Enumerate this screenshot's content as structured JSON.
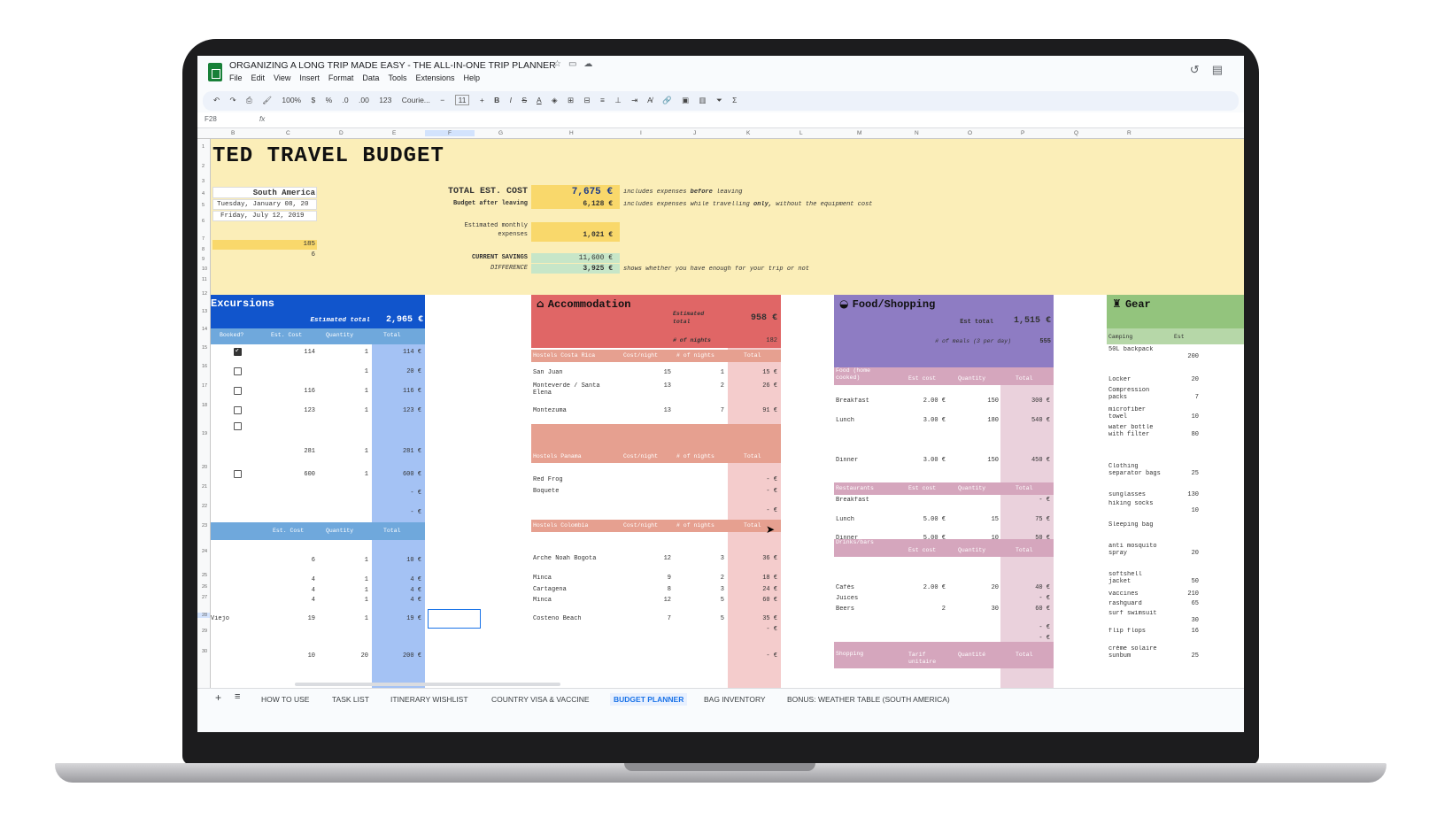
{
  "window": {
    "doc_title": "ORGANIZING A LONG TRIP MADE EASY - THE ALL-IN-ONE TRIP PLANNER",
    "menu": [
      "File",
      "Edit",
      "View",
      "Insert",
      "Format",
      "Data",
      "Tools",
      "Extensions",
      "Help"
    ]
  },
  "toolbar": {
    "zoom": "100%",
    "currency": "$",
    "percent": "%",
    "dec_less": ".0",
    ".00": ".00",
    "format_123": "123",
    "font": "Courie...",
    "font_size": "11"
  },
  "formula": {
    "cell_ref": "F28",
    "fx": "fx"
  },
  "columns": [
    "B",
    "C",
    "D",
    "E",
    "F",
    "G",
    "H",
    "I",
    "J",
    "K",
    "L",
    "M",
    "N",
    "O",
    "P",
    "Q",
    "R"
  ],
  "rows": [
    "1",
    "2",
    "3",
    "4",
    "5",
    "6",
    "7",
    "8",
    "9",
    "10",
    "11",
    "12",
    "13",
    "14",
    "15",
    "16",
    "17",
    "18",
    "19",
    "20",
    "21",
    "22",
    "23",
    "24",
    "25",
    "26",
    "27",
    "28",
    "29",
    "30"
  ],
  "header": {
    "title": "TED TRAVEL BUDGET",
    "destination": "South America",
    "start_date": "Tuesday, January 08, 20",
    "end_date": "Friday, July 12, 2019",
    "days": "185",
    "months": "6",
    "total_label": "TOTAL EST. COST",
    "total_value": "7,675 €",
    "total_note_a": "includes expenses",
    "total_note_b": "before",
    "total_note_c": "leaving",
    "after_label": "Budget after leaving",
    "after_value": "6,128 €",
    "after_note_a": "includes expenses while travelling",
    "after_note_b": "only,",
    "after_note_c": "without the equipment cost",
    "monthly_label_1": "Estimated monthly",
    "monthly_label_2": "expenses",
    "monthly_value": "1,021 €",
    "savings_label": "CURRENT SAVINGS",
    "savings_value": "11,600 €",
    "diff_label": "DIFFERENCE",
    "diff_value": "3,925 €",
    "diff_note": "shows whether you have enough for your trip or not"
  },
  "excursions": {
    "title": "Excursions",
    "est_total_label": "Estimated total",
    "est_total_value": "2,965 €",
    "headers": [
      "Booked?",
      "Est. Cost",
      "Quantity",
      "Total"
    ],
    "rows": [
      {
        "checked": true,
        "cost": "114",
        "qty": "1",
        "total": "114 €"
      },
      {
        "checked": false,
        "cost": "",
        "qty": "1",
        "total": "20 €"
      },
      {
        "checked": false,
        "cost": "116",
        "qty": "1",
        "total": "116 €"
      },
      {
        "checked": false,
        "cost": "123",
        "qty": "1",
        "total": "123 €"
      },
      {
        "checked": false,
        "cost": "281",
        "qty": "1",
        "total": "281 €"
      },
      {
        "checked": false,
        "cost": "600",
        "qty": "1",
        "total": "600 €"
      },
      {
        "checked": false,
        "cost": "",
        "qty": "",
        "total": "- €"
      },
      {
        "checked": false,
        "cost": "",
        "qty": "",
        "total": "- €"
      }
    ],
    "headers2": [
      "Est. Cost",
      "Quantity",
      "Total"
    ],
    "rows2": [
      {
        "name": "",
        "cost": "6",
        "qty": "1",
        "total": "10 €"
      },
      {
        "name": "",
        "cost": "4",
        "qty": "1",
        "total": "4 €"
      },
      {
        "name": "",
        "cost": "4",
        "qty": "1",
        "total": "4 €"
      },
      {
        "name": "",
        "cost": "4",
        "qty": "1",
        "total": "4 €"
      },
      {
        "name": "Viejo",
        "cost": "19",
        "qty": "1",
        "total": "19 €"
      },
      {
        "name": "",
        "cost": "10",
        "qty": "20",
        "total": "200 €"
      }
    ]
  },
  "accommodation": {
    "title": "Accommodation",
    "est_total_label_1": "Estimated",
    "est_total_label_2": "total",
    "est_total_value": "958 €",
    "nights_label": "# of nights",
    "nights_value": "182",
    "groups": [
      {
        "name": "Hostels Costa Rica",
        "cols": [
          "Cost/night",
          "# of nights",
          "Total"
        ],
        "rows": [
          {
            "name": "San Juan",
            "cost": "15",
            "nights": "1",
            "total": "15 €"
          },
          {
            "name": "Monteverde / Santa Elena",
            "cost": "13",
            "nights": "2",
            "total": "26 €"
          },
          {
            "name": "Montezuma",
            "cost": "13",
            "nights": "7",
            "total": "91 €"
          }
        ]
      },
      {
        "name": "Hostels Panama",
        "cols": [
          "Cost/night",
          "# of nights",
          "Total"
        ],
        "rows": [
          {
            "name": "Red Frog",
            "cost": "",
            "nights": "",
            "total": "- €"
          },
          {
            "name": "Boquete",
            "cost": "",
            "nights": "",
            "total": "- €"
          },
          {
            "name": "",
            "cost": "",
            "nights": "",
            "total": "- €"
          }
        ]
      },
      {
        "name": "Hostels Colombia",
        "cols": [
          "Cost/night",
          "# of nights",
          "Total"
        ],
        "rows": [
          {
            "name": "Arche Noah Bogota",
            "cost": "12",
            "nights": "3",
            "total": "36 €"
          },
          {
            "name": "Minca",
            "cost": "9",
            "nights": "2",
            "total": "18 €"
          },
          {
            "name": "Cartagena",
            "cost": "8",
            "nights": "3",
            "total": "24 €"
          },
          {
            "name": "Minca",
            "cost": "12",
            "nights": "5",
            "total": "60 €"
          },
          {
            "name": "Costeno Beach",
            "cost": "7",
            "nights": "5",
            "total": "35 €"
          },
          {
            "name": "",
            "cost": "",
            "nights": "",
            "total": "- €"
          },
          {
            "name": "",
            "cost": "",
            "nights": "",
            "total": "- €"
          }
        ]
      }
    ]
  },
  "food": {
    "title": "Food/Shopping",
    "est_total_label": "Est total",
    "est_total_value": "1,515 €",
    "meals_label": "# of meals (3 per day)",
    "meals_value": "555",
    "groups": [
      {
        "name": "Food (home cooked)",
        "cols": [
          "Est cost",
          "Quantity",
          "Total"
        ],
        "rows": [
          {
            "name": "Breakfast",
            "cost": "2.00 €",
            "qty": "150",
            "total": "300 €"
          },
          {
            "name": "Lunch",
            "cost": "3.00 €",
            "qty": "180",
            "total": "540 €"
          },
          {
            "name": "Dinner",
            "cost": "3.00 €",
            "qty": "150",
            "total": "450 €"
          }
        ]
      },
      {
        "name": "Restaurants",
        "cols": [
          "Est cost",
          "Quantity",
          "Total"
        ],
        "rows": [
          {
            "name": "Breakfast",
            "cost": "",
            "qty": "",
            "total": "- €"
          },
          {
            "name": "Lunch",
            "cost": "5.00 €",
            "qty": "15",
            "total": "75 €"
          },
          {
            "name": "Dinner",
            "cost": "5.00 €",
            "qty": "10",
            "total": "50 €"
          }
        ]
      },
      {
        "name": "Drinks/bars",
        "cols": [
          "Est cost",
          "Quantity",
          "Total"
        ],
        "rows": [
          {
            "name": "Cafés",
            "cost": "2.00 €",
            "qty": "20",
            "total": "40 €"
          },
          {
            "name": "Juices",
            "cost": "",
            "qty": "",
            "total": "- €"
          },
          {
            "name": "Beers",
            "cost": "2",
            "qty": "30",
            "total": "60 €"
          },
          {
            "name": "",
            "cost": "",
            "qty": "",
            "total": "- €"
          },
          {
            "name": "",
            "cost": "",
            "qty": "",
            "total": "- €"
          }
        ]
      },
      {
        "name": "Shopping",
        "cols": [
          "Tarif unitaire",
          "Quantité",
          "Total"
        ],
        "rows": []
      }
    ]
  },
  "gear": {
    "title": "Gear",
    "headers": [
      "Camping",
      "Est"
    ],
    "rows": [
      {
        "name": "50L backpack",
        "cost": "200"
      },
      {
        "name": "Locker",
        "cost": "20"
      },
      {
        "name": "Compression packs",
        "cost": "7"
      },
      {
        "name": "microfiber towel",
        "cost": "10"
      },
      {
        "name": "water bottle with filter",
        "cost": "80"
      },
      {
        "name": "Clothing separator bags",
        "cost": "25"
      },
      {
        "name": "sunglasses",
        "cost": "130"
      },
      {
        "name": "hiking socks",
        "cost": "10"
      },
      {
        "name": "Sleeping bag",
        "cost": ""
      },
      {
        "name": "anti mosquito spray",
        "cost": "20"
      },
      {
        "name": "softshell jacket",
        "cost": "50"
      },
      {
        "name": "vaccines",
        "cost": "210"
      },
      {
        "name": "rashguard",
        "cost": "65"
      },
      {
        "name": "surf swimsuit",
        "cost": "30"
      },
      {
        "name": "flip flops",
        "cost": "16"
      },
      {
        "name": "crème solaire sunbum",
        "cost": "25"
      }
    ]
  },
  "tabs": [
    "HOW TO USE",
    "TASK LIST",
    "ITINERARY WISHLIST",
    "COUNTRY VISA & VACCINE",
    "BUDGET PLANNER",
    "BAG INVENTORY",
    "BONUS: WEATHER TABLE (SOUTH AMERICA)"
  ],
  "colors": {
    "banner": "#fbeeb8",
    "excursions_head": "#1155cc",
    "excursions_col": "#a4c2f4",
    "accommodation_head": "#e06666",
    "accommodation_light": "#f4cccc",
    "food_head": "#8e7cc3",
    "food_light": "#ead1dc",
    "gear_head": "#93c47d",
    "total_yellow": "#f9d86b",
    "savings_green": "#c7e6c8"
  }
}
